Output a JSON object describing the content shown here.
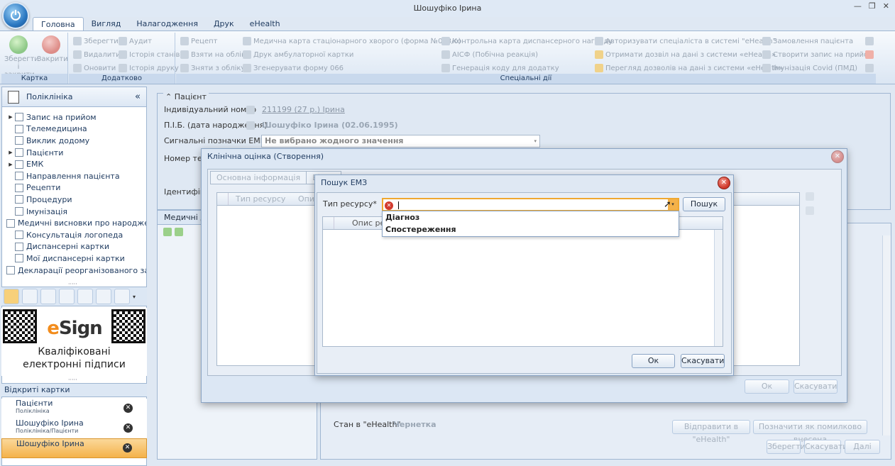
{
  "window": {
    "title": "Шошуфіко Ірина"
  },
  "ribbon_tabs": [
    "Головна",
    "Вигляд",
    "Налагодження",
    "Друк",
    "eHealth"
  ],
  "ribbon": {
    "card_group": {
      "label": "Картка",
      "save_close": "Зберегти і закрити",
      "close": "Закрити"
    },
    "extra_group": {
      "label": "Додатково",
      "save": "Зберегти",
      "delete": "Видалити",
      "refresh": "Оновити",
      "audit": "Аудит",
      "state_history": "Історія станів",
      "print_history": "Історія друку"
    },
    "special_group": {
      "label": "Спеціальні дії",
      "items": [
        "Рецепт",
        "Взяти на облік",
        "Зняти з обліку",
        "Медична карта стаціонарного хворого (форма №003/о)",
        "Друк амбулаторної картки",
        "Згенерувати форму 066",
        "Контрольна карта диспансерного нагляду",
        "АІСФ (Побічна реакція)",
        "Генерація коду для додатку",
        "Авторизувати спеціаліста в системі \"eHealth\"",
        "Отримати дозвіл на дані з системи «eHealth»",
        "Перегляд дозволів на дані з системи «eHealth»",
        "Замовлення пацієнта",
        "Створити запис на прийом",
        "Імунізація Covid (ПМД)"
      ]
    }
  },
  "left_panel": {
    "title": "Поліклініка",
    "nav": [
      {
        "label": "Запис на прийом",
        "expandable": true
      },
      {
        "label": "Телемедицина",
        "expandable": false
      },
      {
        "label": "Виклик додому",
        "expandable": false
      },
      {
        "label": "Пацієнти",
        "expandable": true
      },
      {
        "label": "ЕМК",
        "expandable": true
      },
      {
        "label": "Направлення пацієнта",
        "expandable": false
      },
      {
        "label": "Рецепти",
        "expandable": false
      },
      {
        "label": "Процедури",
        "expandable": false
      },
      {
        "label": "Імунізація",
        "expandable": false
      },
      {
        "label": "Медичні висновки про народженн",
        "expandable": false
      },
      {
        "label": "Консультація логопеда",
        "expandable": false
      },
      {
        "label": "Диспансерні картки",
        "expandable": false
      },
      {
        "label": "Мої диспансерні картки",
        "expandable": false
      },
      {
        "label": "Декларації реорганізованого закл",
        "expandable": false
      }
    ],
    "esign": {
      "logo_text": "eSign",
      "line1": "Кваліфіковані",
      "line2": "електронні підписи"
    },
    "open_cards_title": "Відкриті картки",
    "open_cards": [
      {
        "title": "Пацієнти",
        "sub": "Поліклініка"
      },
      {
        "title": "Шошуфіко Ірина",
        "sub": "Поліклініка/Пацієнти"
      },
      {
        "title": "Шошуфіко Ірина",
        "sub": ""
      }
    ]
  },
  "patient": {
    "section_title": "Пацієнт",
    "id_label": "Індивідуальний номер",
    "id_value": "211199 (27 р.) Ірина",
    "name_label": "П.І.Б. (дата народження)",
    "name_value": "Шошуфіко Ірина (02.06.1995)",
    "signals_label": "Сигнальні позначки ЕМК",
    "signals_value": "Не вибрано жодного значення",
    "phone_label": "Номер теле",
    "ident_label": "Ідентифікат",
    "med_tab": "Медичні до",
    "ehealth_state_label": "Стан в \"eHealth\"",
    "ehealth_state_value": "Чернетка",
    "send_ehealth": "Відправити в \"eHealth\"",
    "mark_wrong": "Позначити як помилково внесена",
    "save": "Зберегти",
    "cancel": "Скасувати",
    "next": "Далі"
  },
  "clinical_dialog": {
    "title": "Клінічна оцінка (Створення)",
    "tabs": [
      "Основна інформація",
      "Відпо"
    ],
    "grid_cols": [
      "Тип ресурсу",
      "Опис"
    ],
    "ok": "Ок",
    "cancel": "Скасувати"
  },
  "emz_dialog": {
    "title": "Пошук ЕМЗ",
    "resource_label": "Тип ресурсу*",
    "resource_value": "",
    "search": "Пошук",
    "grid_col": "Опис ресу",
    "options": [
      "Діагноз",
      "Спостереження"
    ],
    "ok": "Ок",
    "cancel": "Скасувати"
  }
}
